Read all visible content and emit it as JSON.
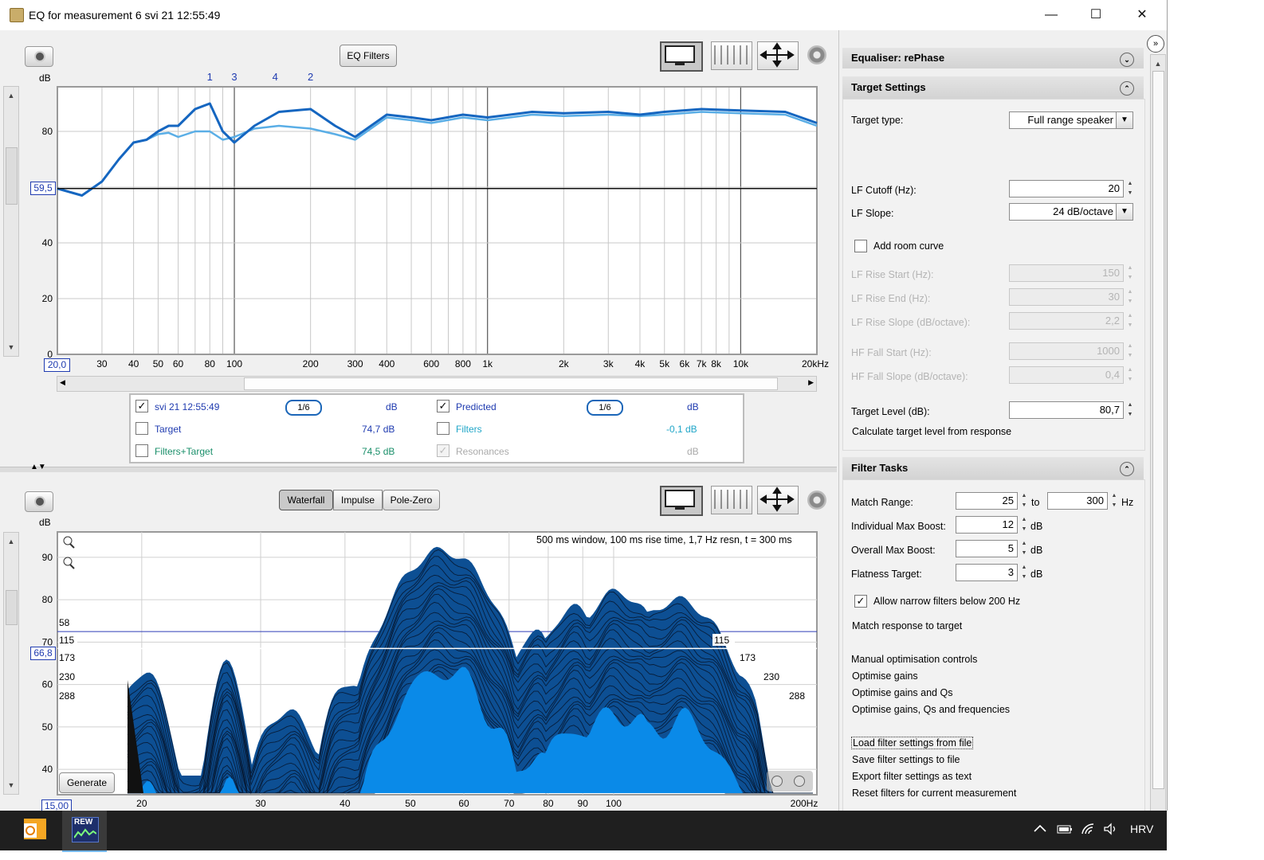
{
  "window": {
    "title": "EQ for measurement 6 svi 21 12:55:49",
    "min": "—",
    "max": "☐",
    "close": "✕"
  },
  "top_toolbar": {
    "eq_filters_label": "EQ Filters"
  },
  "top_graph": {
    "y_unit": "dB",
    "y_ticks": [
      "80",
      "60",
      "40",
      "20",
      "0"
    ],
    "ref_level": "59,5",
    "x_start": "20,0",
    "x_ticks": [
      "30",
      "40",
      "50",
      "60",
      "80",
      "100",
      "200",
      "300",
      "400",
      "600",
      "800",
      "1k",
      "2k",
      "3k",
      "4k",
      "5k",
      "6k",
      "7k",
      "8k",
      "10k",
      "20kHz"
    ],
    "filter_markers": [
      "1",
      "3",
      "4",
      "2"
    ],
    "filter_marker_freqs": [
      80,
      100,
      145,
      200
    ],
    "chart_data": {
      "type": "line",
      "x_scale": "log",
      "xlim": [
        20,
        20000
      ],
      "ylim": [
        0,
        96
      ],
      "ylabel": "dB",
      "series": [
        {
          "name": "svi 21 12:55:49",
          "color": "#5aaee6",
          "x": [
            20,
            25,
            30,
            35,
            40,
            45,
            50,
            55,
            60,
            70,
            80,
            90,
            100,
            120,
            150,
            200,
            250,
            300,
            400,
            500,
            600,
            800,
            1000,
            1500,
            2000,
            3000,
            4000,
            5000,
            7000,
            10000,
            15000,
            20000
          ],
          "y": [
            59.5,
            57,
            62,
            70,
            76,
            77,
            79,
            79.5,
            78,
            80,
            80,
            77,
            78,
            81,
            82,
            81,
            79,
            77,
            85,
            84,
            83,
            85,
            84,
            86,
            85.5,
            86,
            85.5,
            86,
            87,
            86.5,
            86,
            82
          ]
        },
        {
          "name": "Predicted",
          "color": "#1566c0",
          "x": [
            20,
            25,
            30,
            35,
            40,
            45,
            50,
            55,
            60,
            70,
            80,
            90,
            100,
            120,
            150,
            200,
            250,
            300,
            400,
            500,
            600,
            800,
            1000,
            1500,
            2000,
            3000,
            4000,
            5000,
            7000,
            10000,
            15000,
            20000
          ],
          "y": [
            59.5,
            57,
            62,
            70,
            76,
            77,
            80,
            82,
            82,
            88,
            90,
            80,
            76,
            82,
            87,
            88,
            82,
            78,
            86,
            85,
            84,
            86,
            85,
            87,
            86.5,
            87,
            86,
            87,
            88,
            87.5,
            87,
            83
          ]
        }
      ]
    }
  },
  "legend": {
    "r1c1": "svi 21 12:55:49",
    "r1c1_val": "dB",
    "r1c1_smooth": "1/6",
    "r1c2": "Predicted",
    "r1c2_val": "dB",
    "r1c2_smooth": "1/6",
    "r2c1": "Target",
    "r2c1_val": "74,7 dB",
    "r2c2": "Filters",
    "r2c2_val": "-0,1 dB",
    "r3c1": "Filters+Target",
    "r3c1_val": "74,5 dB",
    "r3c2": "Resonances",
    "r3c2_val": "dB"
  },
  "bottom_toolbar": {
    "tabs": [
      "Waterfall",
      "Impulse",
      "Pole-Zero"
    ]
  },
  "waterfall": {
    "y_unit": "dB",
    "y_ticks": [
      "90",
      "80",
      "70",
      "60",
      "50",
      "40"
    ],
    "ref_level": "66,8",
    "x_start": "15,00",
    "x_ticks": [
      "20",
      "30",
      "40",
      "50",
      "60",
      "70",
      "80",
      "90",
      "100",
      "200Hz"
    ],
    "info": "500 ms window, 100 ms rise time,  1,7 Hz resn, t = 300 ms",
    "left_tags": [
      "58",
      "115",
      "173",
      "230",
      "288"
    ],
    "right_tags": [
      "115",
      "173",
      "230",
      "288"
    ],
    "generate_label": "Generate"
  },
  "right_panel": {
    "equaliser_title": "Equaliser: rePhase",
    "target_settings_title": "Target Settings",
    "target_type_label": "Target type:",
    "target_type_value": "Full range speaker",
    "lf_cutoff_label": "LF Cutoff (Hz):",
    "lf_cutoff_value": "20",
    "lf_slope_label": "LF Slope:",
    "lf_slope_value": "24 dB/octave",
    "add_room_curve": "Add room curve",
    "lf_rise_start_label": "LF Rise Start (Hz):",
    "lf_rise_start_value": "150",
    "lf_rise_end_label": "LF Rise End (Hz):",
    "lf_rise_end_value": "30",
    "lf_rise_slope_label": "LF Rise Slope (dB/octave):",
    "lf_rise_slope_value": "2,2",
    "hf_fall_start_label": "HF Fall Start (Hz):",
    "hf_fall_start_value": "1000",
    "hf_fall_slope_label": "HF Fall Slope (dB/octave):",
    "hf_fall_slope_value": "0,4",
    "target_level_label": "Target Level (dB):",
    "target_level_value": "80,7",
    "calc_target": "Calculate target level from response",
    "filter_tasks_title": "Filter Tasks",
    "match_range_label": "Match Range:",
    "match_range_from": "25",
    "match_range_to_label": "to",
    "match_range_to": "300",
    "match_range_unit": "Hz",
    "ind_max_boost_label": "Individual Max Boost:",
    "ind_max_boost_value": "12",
    "overall_max_boost_label": "Overall Max Boost:",
    "overall_max_boost_value": "5",
    "flatness_label": "Flatness Target:",
    "flatness_value": "3",
    "db_unit": "dB",
    "allow_narrow": "Allow narrow filters below 200 Hz",
    "match_response": "Match response to target",
    "manual_opt": "Manual optimisation controls",
    "opt_gains": "Optimise gains",
    "opt_gains_qs": "Optimise gains and Qs",
    "opt_gains_qs_freqs": "Optimise gains, Qs and frequencies",
    "load_filters": "Load filter settings from file",
    "save_filters": "Save filter settings to file",
    "export_filters": "Export filter settings as text",
    "reset_filters": "Reset filters for current measurement"
  },
  "taskbar": {
    "app_label": "REW",
    "lang": "HRV"
  },
  "colors": {
    "measurement": "#5aaee6",
    "predicted": "#1566c0",
    "waterfall_fill": "#0a8ae8",
    "marker": "#1f3bb0"
  }
}
